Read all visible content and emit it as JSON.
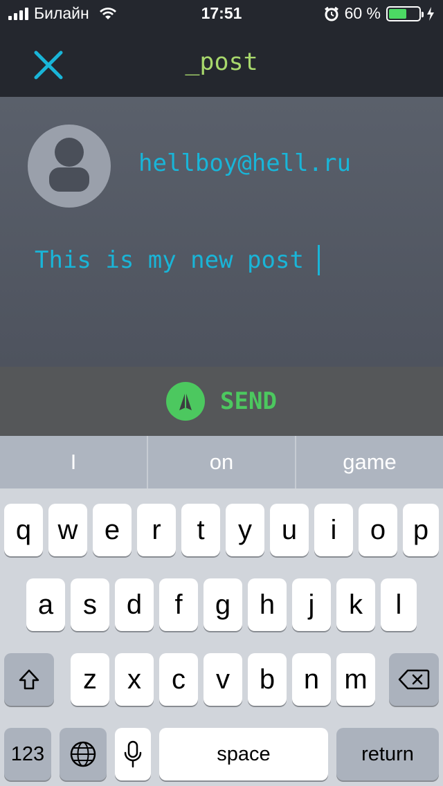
{
  "status": {
    "carrier": "Билайн",
    "time": "17:51",
    "battery": "60 %",
    "battery_level": 0.6
  },
  "nav": {
    "title": "_post"
  },
  "compose": {
    "author": "hellboy@hell.ru",
    "text": "This is my new post"
  },
  "send": {
    "label": "SEND"
  },
  "suggestions": [
    "I",
    "on",
    "game"
  ],
  "keyboard": {
    "row1": [
      "q",
      "w",
      "e",
      "r",
      "t",
      "y",
      "u",
      "i",
      "o",
      "p"
    ],
    "row2": [
      "a",
      "s",
      "d",
      "f",
      "g",
      "h",
      "j",
      "k",
      "l"
    ],
    "row3": [
      "z",
      "x",
      "c",
      "v",
      "b",
      "n",
      "m"
    ],
    "numbers": "123",
    "space": "space",
    "return": "return"
  },
  "colors": {
    "accent": "#19b5d8",
    "title": "#a8d86c",
    "send": "#4cc85f"
  }
}
